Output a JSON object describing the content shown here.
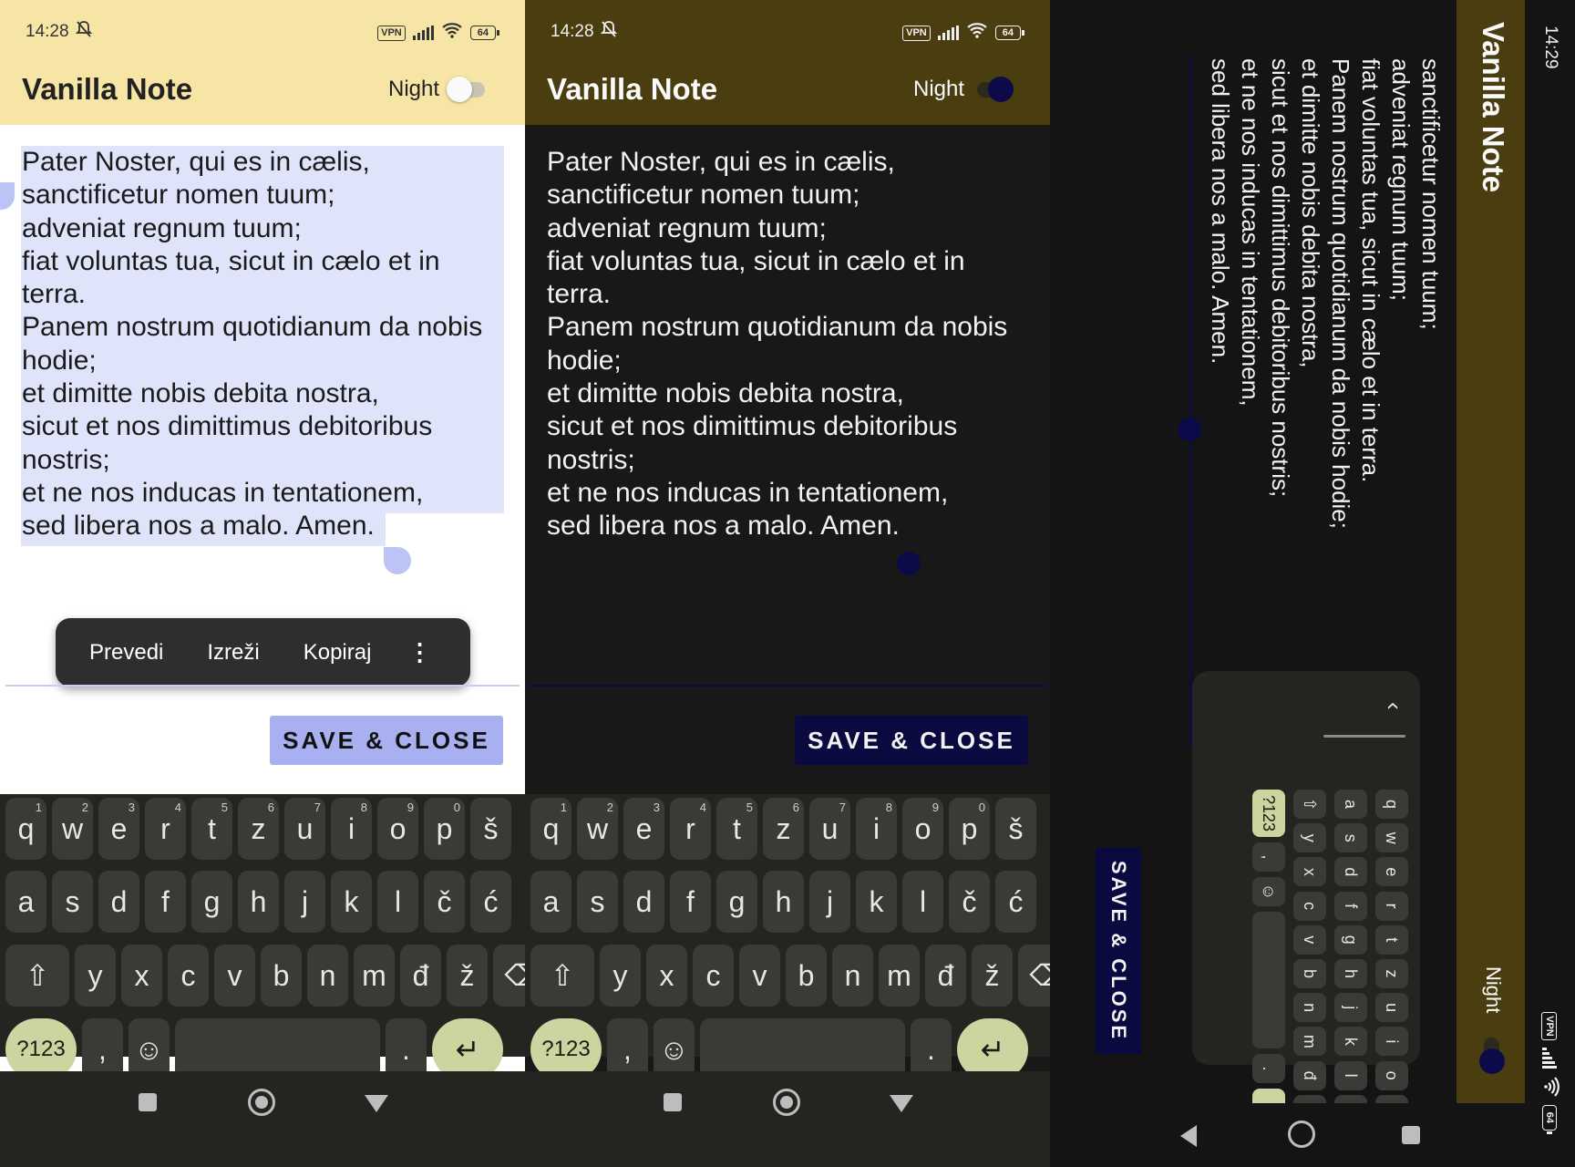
{
  "app": {
    "title": "Vanilla Note",
    "night_label": "Night"
  },
  "status": {
    "time_portrait": "14:28",
    "time_landscape": "14:29",
    "vpn": "VPN",
    "battery": "64"
  },
  "note_text": "Pater Noster, qui es in cælis,\nsanctificetur nomen tuum;\nadveniat regnum tuum;\nfiat voluntas tua, sicut in cælo et in terra.\nPanem nostrum quotidianum da nobis hodie;\net dimitte nobis debita nostra,\nsicut et nos dimittimus debitoribus nostris;\net ne nos inducas in tentationem,\nsed libera nos a malo. Amen.",
  "note_text_landscape": "sanctificetur nomen tuum;\nadveniat regnum tuum;\nfiat voluntas tua, sicut in cælo et in terra.\nPanem nostrum quotidianum da nobis hodie;\net dimitte nobis debita nostra,\nsicut et nos dimittimus debitoribus nostris;\net ne nos inducas in tentationem,\nsed libera nos a malo. Amen.",
  "context_menu": {
    "translate": "Prevedi",
    "cut": "Izreži",
    "copy": "Kopiraj",
    "more": "⋮"
  },
  "save_button": "SAVE & CLOSE",
  "keyboard": {
    "row1": [
      "q",
      "w",
      "e",
      "r",
      "t",
      "z",
      "u",
      "i",
      "o",
      "p",
      "š"
    ],
    "row1_hints": [
      "1",
      "2",
      "3",
      "4",
      "5",
      "6",
      "7",
      "8",
      "9",
      "0",
      ""
    ],
    "row2": [
      "a",
      "s",
      "d",
      "f",
      "g",
      "h",
      "j",
      "k",
      "l",
      "č",
      "ć"
    ],
    "row3": [
      "y",
      "x",
      "c",
      "v",
      "b",
      "n",
      "m",
      "đ",
      "ž"
    ],
    "symbols": "?123",
    "comma": ",",
    "period": ".",
    "emoji": "☺",
    "shift": "⇧",
    "backspace": "⌫",
    "enter": "↵",
    "collapse": "‹"
  },
  "colors": {
    "light_header": "#f7e5a6",
    "dark_header": "#4a3d10",
    "light_save_bg": "#a8b0f2",
    "dark_save_bg": "#0a0a40",
    "selection": "#e0e4fb",
    "switch_on_thumb": "#0d0a4a"
  },
  "icons": {
    "bell": "bell-off-icon",
    "wifi": "wifi-icon",
    "signal": "signal-icon",
    "battery": "battery-icon",
    "nav_recents": "square-icon",
    "nav_home": "circle-icon",
    "nav_back": "triangle-icon"
  }
}
